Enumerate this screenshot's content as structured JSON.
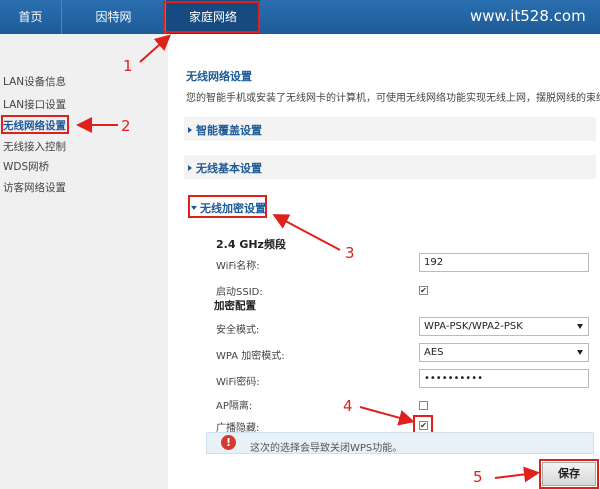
{
  "nav": {
    "tabs": [
      {
        "label": "首页"
      },
      {
        "label": "因特网"
      },
      {
        "label": "家庭网络"
      }
    ],
    "watermark": "www.it528.com"
  },
  "sidebar": {
    "items": [
      {
        "label": "LAN设备信息"
      },
      {
        "label": "LAN接口设置"
      },
      {
        "label": "无线网络设置"
      },
      {
        "label": "无线接入控制"
      },
      {
        "label": "WDS网桥"
      },
      {
        "label": "访客网络设置"
      }
    ]
  },
  "main": {
    "title": "无线网络设置",
    "description": "您的智能手机或安装了无线网卡的计算机，可使用无线网络功能实现无线上网，摆脱网线的束缚。",
    "sections": [
      {
        "label": "智能覆盖设置"
      },
      {
        "label": "无线基本设置"
      },
      {
        "label": "无线加密设置"
      }
    ],
    "band_title": "2.4 GHz频段",
    "wifi_name_label": "WiFi名称:",
    "wifi_name_value": "192",
    "enable_ssid_label": "启动SSID:",
    "enable_ssid_checked": true,
    "encryption_title": "加密配置",
    "security_mode_label": "安全模式:",
    "security_mode_value": "WPA-PSK/WPA2-PSK",
    "wpa_mode_label": "WPA 加密模式:",
    "wpa_mode_value": "AES",
    "password_label": "WiFi密码:",
    "password_value": "••••••••••",
    "ap_isolation_label": "AP隔离:",
    "ap_isolation_checked": false,
    "hide_broadcast_label": "广播隐藏:",
    "hide_broadcast_checked": true,
    "warning_icon": "!",
    "warning_text": "这次的选择会导致关闭WPS功能。",
    "save_label": "保存"
  },
  "annotations": {
    "step1": "1",
    "step2": "2",
    "step3": "3",
    "step4": "4",
    "step5": "5"
  },
  "colors": {
    "nav_blue": "#1e5b97",
    "annotation_red": "#e0201b",
    "warning_red": "#d43a2f"
  },
  "icons": {
    "warning": "alert-circle-icon",
    "checkbox_checked": "checkmark-icon"
  }
}
